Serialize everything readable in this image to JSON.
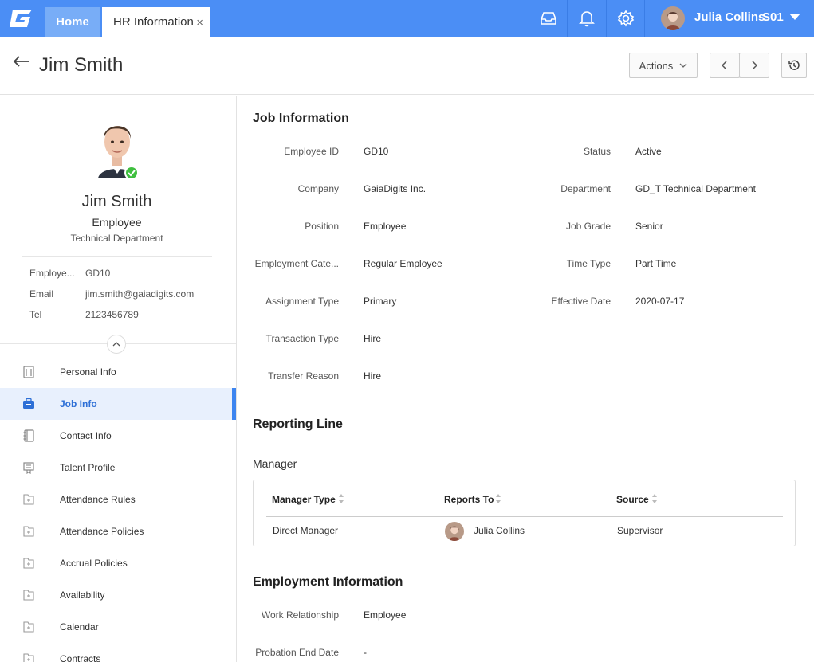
{
  "topbar": {
    "tabs": [
      {
        "label": "Home"
      },
      {
        "label": "HR Information",
        "close": "×"
      }
    ],
    "icons": [
      "inbox-icon",
      "bell-icon",
      "gear-icon"
    ],
    "user": {
      "name": "Julia Collins",
      "code": "S01"
    },
    "colors": {
      "bar": "#4b8ef5",
      "active_tab": "#78adf7"
    }
  },
  "header": {
    "title": "Jim Smith",
    "actions_label": "Actions"
  },
  "profile": {
    "name": "Jim Smith",
    "role": "Employee",
    "department": "Technical Department",
    "fields": [
      {
        "label": "Employe...",
        "value": "GD10"
      },
      {
        "label": "Email",
        "value": "jim.smith@gaiadigits.com"
      },
      {
        "label": "Tel",
        "value": "2123456789"
      }
    ]
  },
  "nav": [
    {
      "label": "Personal Info",
      "icon": "person-card-icon"
    },
    {
      "label": "Job Info",
      "icon": "briefcase-icon",
      "active": true
    },
    {
      "label": "Contact Info",
      "icon": "address-book-icon"
    },
    {
      "label": "Talent Profile",
      "icon": "certificate-icon"
    },
    {
      "label": "Attendance Rules",
      "icon": "folder-plus-icon"
    },
    {
      "label": "Attendance Policies",
      "icon": "folder-plus-icon"
    },
    {
      "label": "Accrual Policies",
      "icon": "folder-plus-icon"
    },
    {
      "label": "Availability",
      "icon": "folder-plus-icon"
    },
    {
      "label": "Calendar",
      "icon": "folder-plus-icon"
    },
    {
      "label": "Contracts",
      "icon": "folder-plus-icon"
    }
  ],
  "job_info": {
    "title": "Job Information",
    "left": [
      {
        "label": "Employee ID",
        "value": "GD10"
      },
      {
        "label": "Company",
        "value": "GaiaDigits Inc."
      },
      {
        "label": "Position",
        "value": "Employee"
      },
      {
        "label": "Employment Cate...",
        "value": "Regular Employee"
      },
      {
        "label": "Assignment Type",
        "value": "Primary"
      },
      {
        "label": "Transaction Type",
        "value": "Hire"
      },
      {
        "label": "Transfer Reason",
        "value": "Hire"
      }
    ],
    "right": [
      {
        "label": "Status",
        "value": "Active"
      },
      {
        "label": "Department",
        "value": "GD_T Technical Department"
      },
      {
        "label": "Job Grade",
        "value": "Senior"
      },
      {
        "label": "Time Type",
        "value": "Part Time"
      },
      {
        "label": "Effective Date",
        "value": "2020-07-17"
      }
    ]
  },
  "reporting": {
    "title": "Reporting Line",
    "subtitle": "Manager",
    "columns": [
      "Manager Type",
      "Reports To",
      "Source"
    ],
    "rows": [
      {
        "type": "Direct Manager",
        "reports_to": "Julia Collins",
        "source": "Supervisor"
      }
    ]
  },
  "employment": {
    "title": "Employment Information",
    "fields": [
      {
        "label": "Work Relationship",
        "value": "Employee"
      },
      {
        "label": "Probation End Date",
        "value": "-"
      }
    ]
  }
}
